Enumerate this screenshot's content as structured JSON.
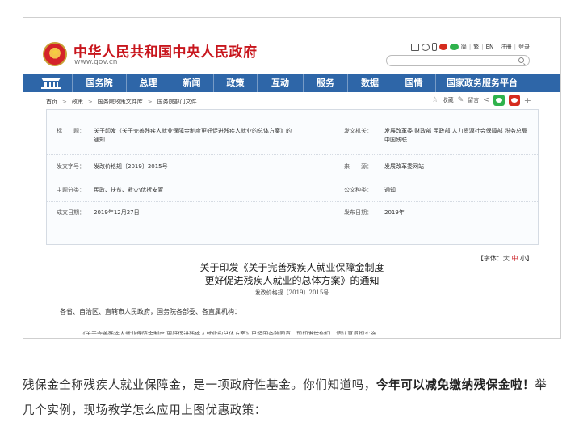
{
  "header": {
    "site_title": "中华人民共和国中央人民政府",
    "site_url": "www.gov.cn",
    "links": {
      "traditional_label": "简",
      "traditional2_label": "繁",
      "en_label": "EN",
      "register_label": "注册",
      "login_label": "登录",
      "separator": "|"
    },
    "search": {
      "placeholder": "",
      "value": ""
    }
  },
  "nav": {
    "items": [
      {
        "label": "国务院"
      },
      {
        "label": "总理"
      },
      {
        "label": "新闻"
      },
      {
        "label": "政策"
      },
      {
        "label": "互动"
      },
      {
        "label": "服务"
      },
      {
        "label": "数据"
      },
      {
        "label": "国情"
      },
      {
        "label": "国家政务服务平台"
      }
    ]
  },
  "breadcrumb": {
    "items": [
      "首页",
      "政策",
      "国务院政策文件库",
      "国务院部门文件"
    ],
    "arrow": ">"
  },
  "tools": {
    "favorite_label": "收藏",
    "comment_label": "留言",
    "plus": "+"
  },
  "meta": {
    "title_key": "标　　题：",
    "title_value": "关于印发《关于完善残疾人就业保障金制度更好促进残疾人就业的总体方案》的通知",
    "issuer_key": "发文机关：",
    "issuer_value": "发展改革委 财政部 民政部 人力资源社会保障部 税务总局 中国残联",
    "doc_no_key": "发文字号：",
    "doc_no_value": "发改价格规〔2019〕2015号",
    "source_key": "来　　源：",
    "source_value": "发展改革委网站",
    "topic_key": "主题分类：",
    "topic_value": "民政、扶贫、救灾\\优抚安置",
    "genre_key": "公文种类：",
    "genre_value": "通知",
    "written_key": "成文日期：",
    "written_value": "2019年12月27日",
    "published_key": "发布日期：",
    "published_value": "2019年"
  },
  "fontsize": {
    "prefix": "【字体：",
    "large": "大",
    "medium": "中",
    "small": "小",
    "suffix": "】"
  },
  "document": {
    "title_line1": "关于印发《关于完善残疾人就业保障金制度",
    "title_line2": "更好促进残疾人就业的总体方案》的通知",
    "doc_no": "发改价格规〔2019〕2015号",
    "addressee": "各省、自治区、直辖市人民政府，国务院各部委、各直属机构：",
    "first_line": "《关于完善残疾人就业保障金制度 更好促进残疾人就业的总体方案》已经国务院同意，现印发给你们，请认真贯彻实施。"
  },
  "article": {
    "part1": "残保金全称残疾人就业保障金，是一项政府性基金。你们知道吗，",
    "bold": "今年可以减免缴纳残保金啦！",
    "part2": "举几个实例，现场教学怎么应用上图优惠政策："
  }
}
